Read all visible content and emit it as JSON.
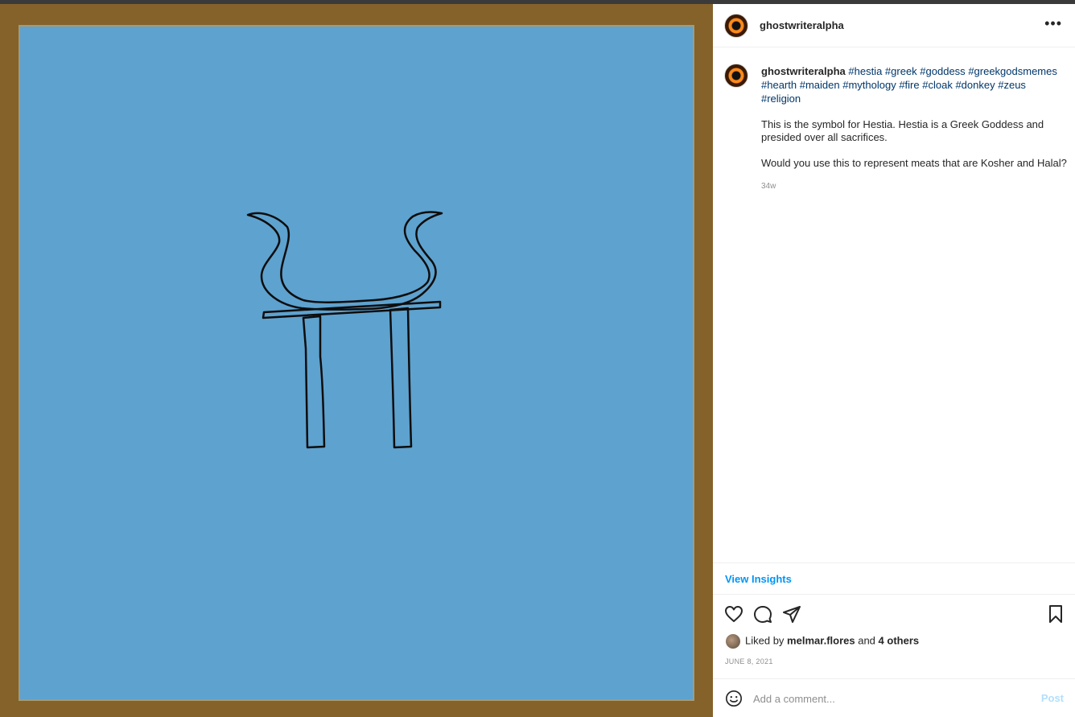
{
  "post": {
    "username": "ghostwriteralpha",
    "more_label": "•••",
    "caption": {
      "username": "ghostwriteralpha",
      "hashtags": [
        "#hestia",
        "#greek",
        "#goddess",
        "#greekgodsmemes",
        "#hearth",
        "#maiden",
        "#mythology",
        "#fire",
        "#cloak",
        "#donkey",
        "#zeus",
        "#religion"
      ],
      "text": "This is the symbol for Hestia. Hestia is a Greek Goddess and presided over all sacrifices.\n\nWould you use this to represent meats that are Kosher and Halal?",
      "age": "34w"
    },
    "insights_label": "View Insights",
    "likes": {
      "prefix": "Liked by",
      "user": "melmar.flores",
      "joiner": "and",
      "others": "4 others"
    },
    "date": "JUNE 8, 2021",
    "comment": {
      "placeholder": "Add a comment...",
      "post_label": "Post"
    }
  },
  "icons": [
    "heart-icon",
    "comment-icon",
    "share-icon",
    "bookmark-icon",
    "emoji-icon",
    "more-icon"
  ],
  "colors": {
    "frame": "#84622a",
    "canvas": "#5ea2cf",
    "link": "#00376b",
    "accent": "#0095f6"
  }
}
